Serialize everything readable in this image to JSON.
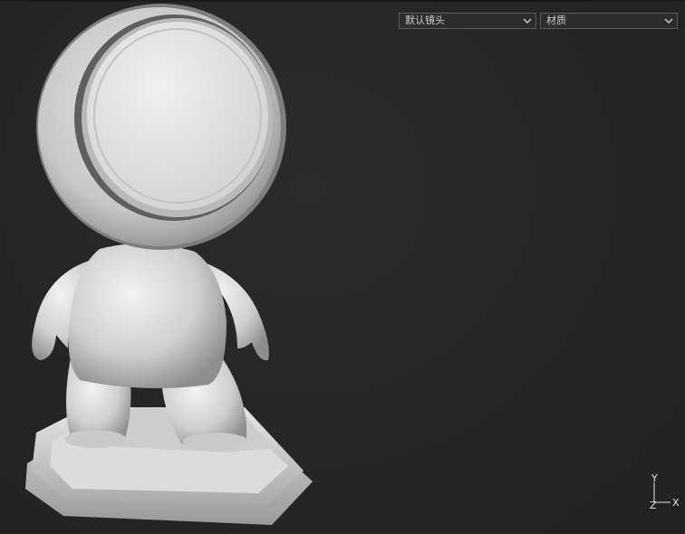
{
  "viewport": {
    "camera_select": {
      "value": "默认镜头"
    },
    "material_select": {
      "value": "材质"
    }
  },
  "axis_gizmo": {
    "y_label": "Y",
    "x_label": "X",
    "z_label": "Z"
  },
  "colors": {
    "background": "#262626",
    "model": "#d4d4d4",
    "dropdown_border": "#5a5a5a"
  },
  "icons": {
    "dropdown": "chevron-down-icon"
  }
}
